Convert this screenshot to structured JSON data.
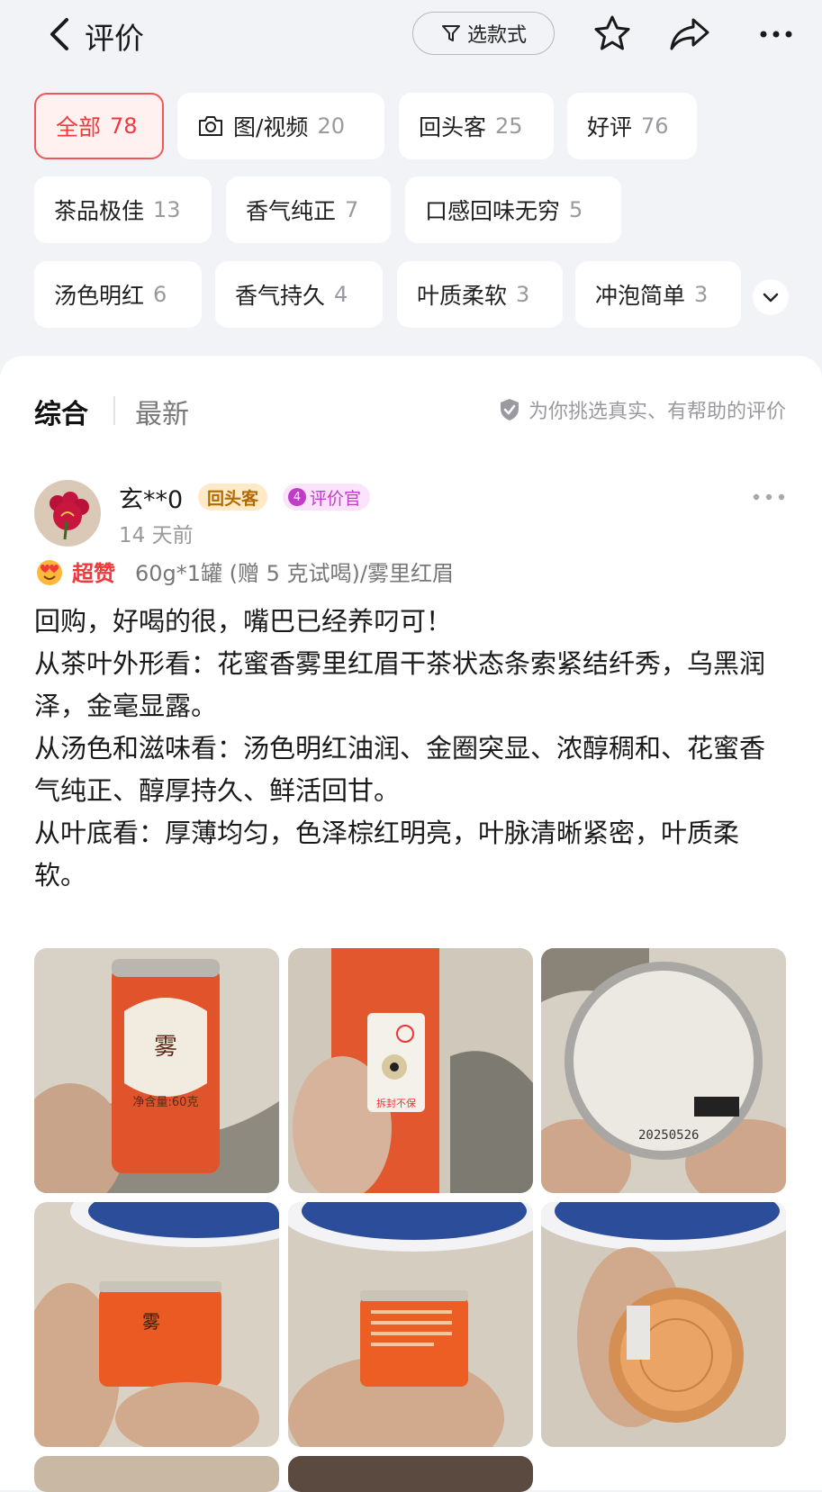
{
  "header": {
    "title": "评价",
    "filter_label": "选款式"
  },
  "tags": [
    {
      "label": "全部",
      "count": "78"
    },
    {
      "label": "图/视频",
      "count": "20"
    },
    {
      "label": "回头客",
      "count": "25"
    },
    {
      "label": "好评",
      "count": "76"
    },
    {
      "label": "茶品极佳",
      "count": "13"
    },
    {
      "label": "香气纯正",
      "count": "7"
    },
    {
      "label": "口感回味无穷",
      "count": "5"
    },
    {
      "label": "汤色明红",
      "count": "6"
    },
    {
      "label": "香气持久",
      "count": "4"
    },
    {
      "label": "叶质柔软",
      "count": "3"
    },
    {
      "label": "冲泡简单",
      "count": "3"
    }
  ],
  "sort": {
    "comprehensive": "综合",
    "latest": "最新",
    "tip": "为你挑选真实、有帮助的评价"
  },
  "review": {
    "username": "玄**0",
    "badge_returning": "回头客",
    "badge_reviewer_level": "4",
    "badge_reviewer": "评价官",
    "time": "14 天前",
    "rating_label": "超赞",
    "spec": "60g*1罐 (赠 5 克试喝)/雾里红眉",
    "text": "回购，好喝的很，嘴巴已经养叼可！\n从茶叶外形看：花蜜香雾里红眉干茶状态条索紧结纤秀，乌黑润泽，金毫显露。\n从汤色和滋味看：汤色明红油润、金圈突显、浓醇稠和、花蜜香气纯正、醇厚持久、鲜活回甘。\n从叶底看：厚薄均匀，色泽棕红明亮，叶脉清晰紧密，叶质柔软。",
    "photo_texts": {
      "can_label": "净含量:60克",
      "date_code": "20250526",
      "seal_text": "拆封不保"
    }
  },
  "colors": {
    "accent": "#f0393d",
    "tag_bg": "#ffffff",
    "page_bg": "#f2f3f7"
  }
}
